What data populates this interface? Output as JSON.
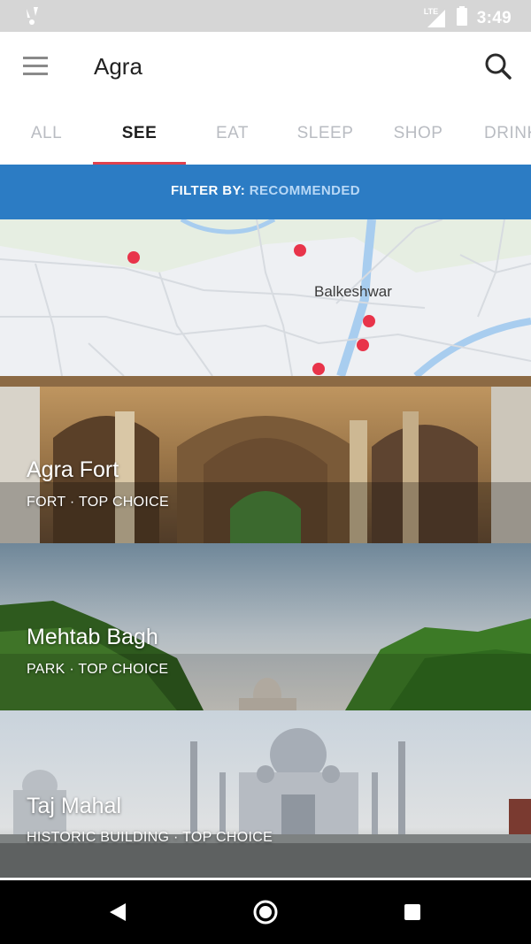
{
  "status_bar": {
    "time": "3:49",
    "network_label": "LTE",
    "icons": [
      "notification-icon",
      "signal-icon",
      "battery-icon"
    ]
  },
  "app_bar": {
    "title": "Agra",
    "menu_icon": "menu-icon",
    "search_icon": "search-icon"
  },
  "tabs": [
    {
      "label": "ALL",
      "active": false
    },
    {
      "label": "SEE",
      "active": true
    },
    {
      "label": "EAT",
      "active": false
    },
    {
      "label": "SLEEP",
      "active": false
    },
    {
      "label": "SHOP",
      "active": false
    },
    {
      "label": "DRINK",
      "active": false
    }
  ],
  "filter": {
    "label": "FILTER BY:",
    "value": "RECOMMENDED"
  },
  "map": {
    "place_label": "Balkeshwar",
    "marker_count": 5
  },
  "places": [
    {
      "name": "Agra Fort",
      "category": "FORT · TOP CHOICE"
    },
    {
      "name": "Mehtab Bagh",
      "category": "PARK · TOP CHOICE"
    },
    {
      "name": "Taj Mahal",
      "category": "HISTORIC BUILDING · TOP CHOICE"
    }
  ],
  "nav_bar": {
    "icons": [
      "back-icon",
      "home-icon",
      "recents-icon"
    ]
  },
  "colors": {
    "accent": "#e0424e",
    "filter_bar": "#2c7cc4",
    "marker": "#e8344a"
  }
}
